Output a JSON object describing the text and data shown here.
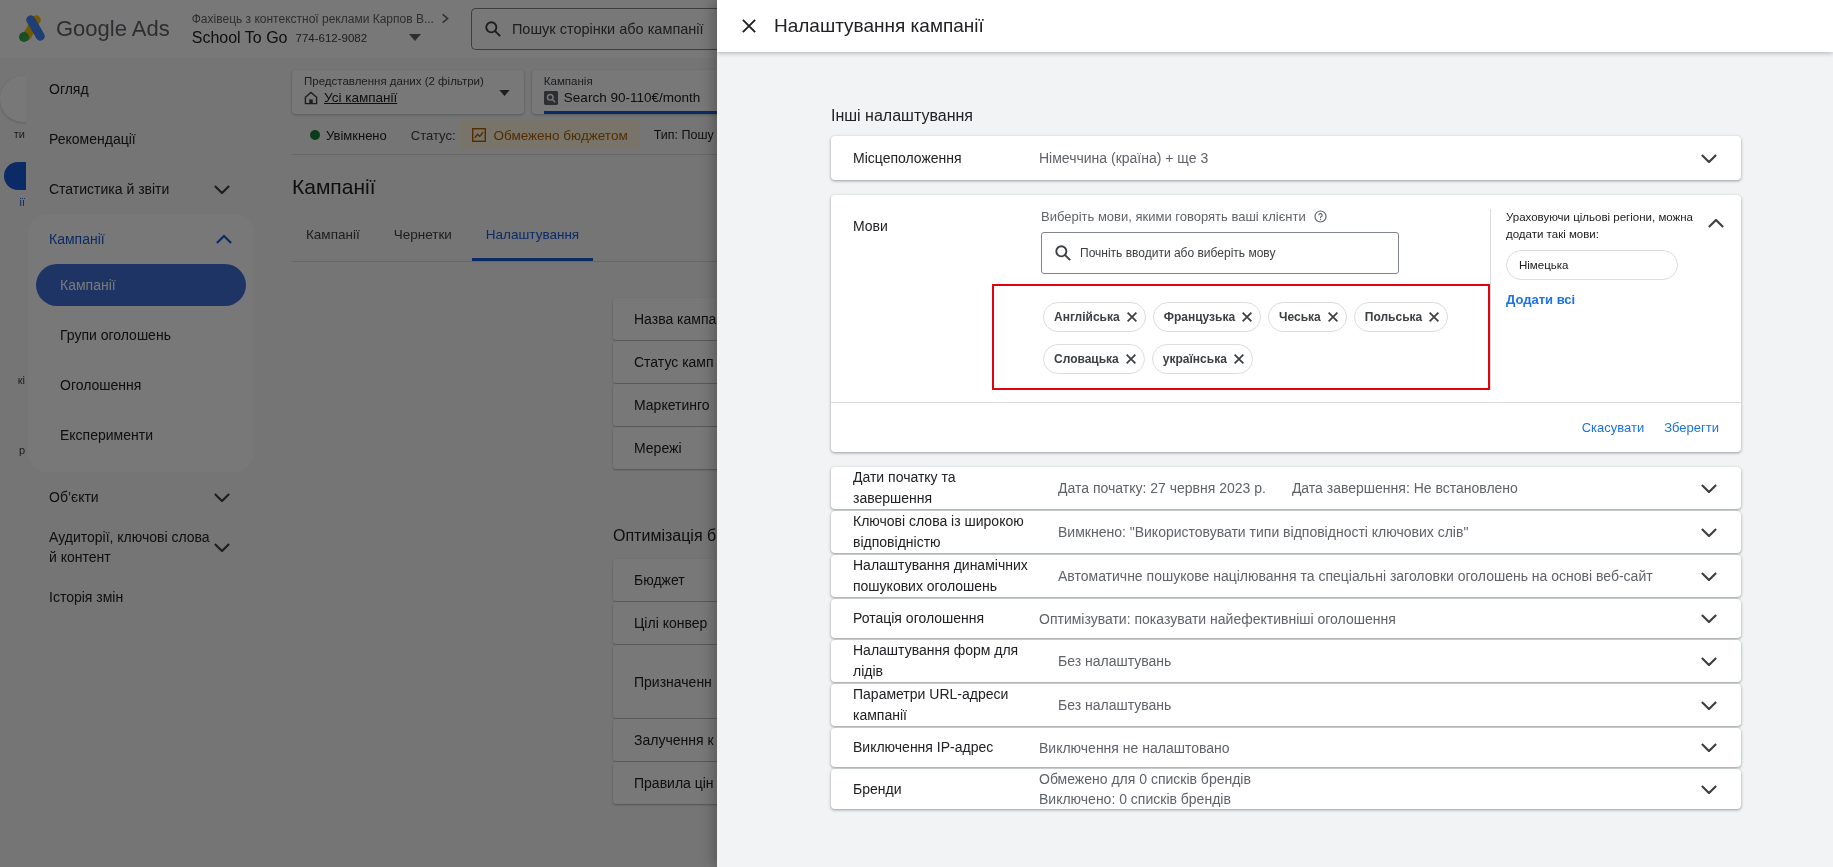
{
  "app": {
    "logo_text": "Google Ads",
    "account_path": "Фахівець з контекстної реклами Карпов В...",
    "account_name": "School To Go",
    "account_id": "774-612-9082",
    "search": {
      "placeholder": "Пошук сторінки або кампанії"
    }
  },
  "rail": [
    {
      "kind": "button",
      "text": "ти",
      "selected": false
    },
    {
      "kind": "button",
      "text": "ії",
      "selected": true
    },
    {
      "kind": "label",
      "text": "кі",
      "selected": false
    },
    {
      "kind": "label",
      "text": "р",
      "selected": false
    }
  ],
  "sidebar": {
    "items": [
      {
        "label": "Огляд"
      },
      {
        "label": "Рекомендації"
      },
      {
        "label": "Статистика й звіти",
        "expanded": false
      },
      {
        "label": "Кампанії",
        "expanded": true,
        "children": [
          {
            "label": "Кампанії",
            "selected": true
          },
          {
            "label": "Групи оголошень",
            "selected": false
          },
          {
            "label": "Оголошення",
            "selected": false
          },
          {
            "label": "Експерименти",
            "selected": false
          }
        ]
      },
      {
        "label": "Об’єкти",
        "expanded": false
      },
      {
        "label": "Аудиторії, ключові слова й контент",
        "expanded": false
      },
      {
        "label": "Історія змін"
      }
    ]
  },
  "filters": [
    {
      "label": "Представлення даних (2 фільтри)",
      "value": "Усі кампанії",
      "kind": "view"
    },
    {
      "label": "Кампанія",
      "value": "Search 90-110€/month",
      "kind": "campaign"
    }
  ],
  "status_row": {
    "state": "Увімкнено",
    "status_label": "Статус:",
    "status_value": "Обмежено бюджетом",
    "type_text": "Тип: Пошу"
  },
  "page_title": "Кампанії",
  "tabs": [
    {
      "label": "Кампанії",
      "selected": false
    },
    {
      "label": "Чернетки",
      "selected": false
    },
    {
      "label": "Налаштування",
      "selected": true
    }
  ],
  "settings_groups": [
    {
      "rows": [
        {
          "label": "Назва кампа",
          "kind": "single"
        },
        {
          "label": "Статус камп",
          "kind": "single"
        },
        {
          "label": "Маркетинго",
          "kind": "single"
        },
        {
          "label": "Мережі",
          "kind": "single"
        }
      ]
    },
    {
      "title": "Оптимізація б",
      "rows": [
        {
          "label": "Бюджет",
          "kind": "single"
        },
        {
          "label": "Цілі конвер",
          "kind": "single"
        },
        {
          "label": "Призначенн",
          "kind": "tall"
        },
        {
          "label": "Залучення к",
          "kind": "single"
        },
        {
          "label": "Правила цін",
          "kind": "single"
        }
      ]
    }
  ],
  "panel": {
    "title": "Налаштування кампанії",
    "section_title": "Інші налаштування",
    "settings": [
      {
        "kind": "summary",
        "label": "Місцеположення",
        "values": [
          "Німеччина (країна) + ще 3"
        ],
        "expanded": false
      },
      {
        "kind": "languages",
        "label": "Мови",
        "expanded": true,
        "hint": "Виберіть мови, якими говорять ваші клієнти",
        "search": {
          "placeholder": "Почніть вводити або виберіть мову"
        },
        "highlighted": true,
        "chosen": [
          "Англійська",
          "Французька",
          "Чеська",
          "Польська",
          "Словацька",
          "українська"
        ],
        "suggestion_title": "Ураховуючи цільові регіони, можна додати такі мови:",
        "suggestions": [
          "Німецька"
        ],
        "add_all": "Додати всі",
        "actions": [
          "Скасувати",
          "Зберегти"
        ]
      },
      {
        "kind": "inline",
        "label": "Дати початку та завершення",
        "values": [
          "Дата початку: 27 червня 2023 р.",
          "Дата завершення: Не встановлено"
        ],
        "expanded": false
      },
      {
        "kind": "summary",
        "label": "Ключові слова із широкою відповідністю",
        "values": [
          "Вимкнено: \"Використовувати типи відповідності ключових слів\""
        ],
        "expanded": false
      },
      {
        "kind": "summary",
        "label": "Налаштування динамічних пошукових оголошень",
        "values": [
          "Автоматичне пошукове націлювання та спеціальні заголовки оголошень на основі веб-сайт"
        ],
        "expanded": false
      },
      {
        "kind": "summary",
        "label": "Ротація оголошення",
        "values": [
          "Оптимізувати: показувати найефективніші оголошення"
        ],
        "expanded": false
      },
      {
        "kind": "summary",
        "label": "Налаштування форм для лідів",
        "values": [
          "Без налаштувань"
        ],
        "expanded": false
      },
      {
        "kind": "summary",
        "label": "Параметри URL-адреси кампанії",
        "values": [
          "Без налаштувань"
        ],
        "expanded": false
      },
      {
        "kind": "summary",
        "label": "Виключення IP-адрес",
        "values": [
          "Виключення не налаштовано"
        ],
        "expanded": false
      },
      {
        "kind": "summary",
        "label": "Бренди",
        "values": [
          "Обмежено для 0 списків брендів",
          "Виключено: 0 списків брендів"
        ],
        "expanded": false
      }
    ]
  }
}
